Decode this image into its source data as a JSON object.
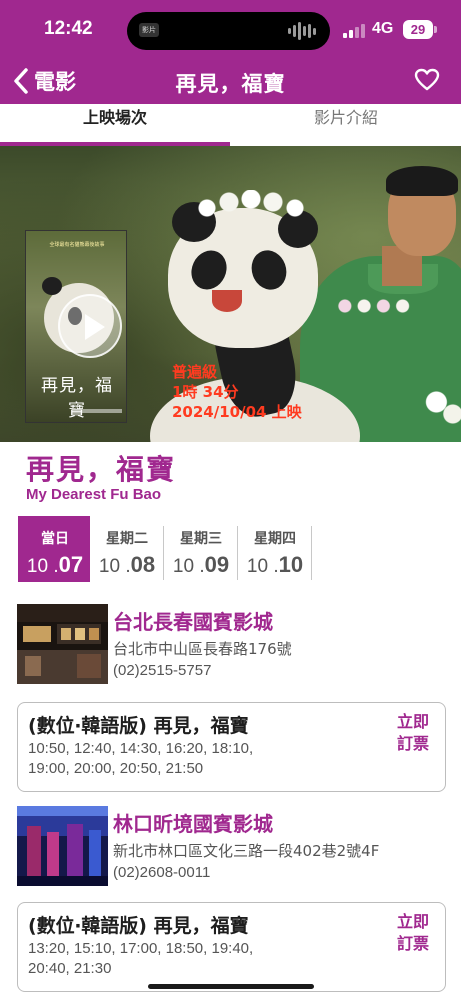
{
  "status": {
    "time": "12:42",
    "network": "4G",
    "battery": "29",
    "island_app": "影片"
  },
  "nav": {
    "back_label": "電影",
    "title": "再見，福寶"
  },
  "tabs": [
    {
      "label": "上映場次"
    },
    {
      "label": "影片介紹"
    }
  ],
  "hero": {
    "rating": "普遍級",
    "duration": "1時 34分",
    "release": "2024/10/04 上映",
    "poster_title": "再見，福寶",
    "poster_tagline": "全球最有名貓熊幕後故事"
  },
  "movie": {
    "title": "再見，福寶",
    "title_en": "My Dearest Fu Bao"
  },
  "dates": [
    {
      "weekday": "當日",
      "month": "10",
      "day": "07",
      "active": true
    },
    {
      "weekday": "星期二",
      "month": "10",
      "day": "08",
      "active": false
    },
    {
      "weekday": "星期三",
      "month": "10",
      "day": "09",
      "active": false
    },
    {
      "weekday": "星期四",
      "month": "10",
      "day": "10",
      "active": false
    }
  ],
  "cinemas": [
    {
      "name": "台北長春國賓影城",
      "address": "台北市中山區長春路176號",
      "phone": "(02)2515-5757",
      "show": {
        "title": "(數位‧韓語版) 再見，福寶",
        "times_line1": "10:50, 12:40, 14:30, 16:20, 18:10,",
        "times_line2": "19:00, 20:00, 20:50, 21:50",
        "buy_label_1": "立即",
        "buy_label_2": "訂票"
      }
    },
    {
      "name": "林口昕境國賓影城",
      "address": "新北市林口區文化三路一段402巷2號4F",
      "phone": "(02)2608-0011",
      "show": {
        "title": "(數位‧韓語版) 再見，福寶",
        "times_line1": "13:20, 15:10, 17:00, 18:50, 19:40,",
        "times_line2": "20:40, 21:30",
        "buy_label_1": "立即",
        "buy_label_2": "訂票"
      }
    }
  ],
  "colors": {
    "brand": "#a0288f",
    "info_red": "#ff3b20"
  }
}
